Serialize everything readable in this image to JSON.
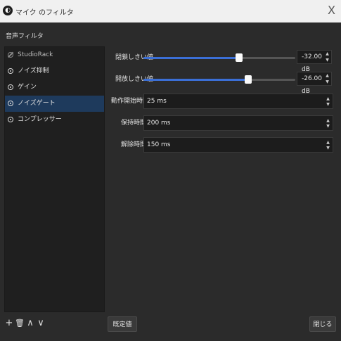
{
  "window": {
    "title": "マイク のフィルタ",
    "close_glyph": "X",
    "app_icon": "obs-logo"
  },
  "section_label": "音声フィルタ",
  "filters": [
    {
      "label": "StudioRack",
      "enabled": false,
      "selected": false
    },
    {
      "label": "ノイズ抑制",
      "enabled": true,
      "selected": false
    },
    {
      "label": "ゲイン",
      "enabled": true,
      "selected": false
    },
    {
      "label": "ノイズゲート",
      "enabled": true,
      "selected": true
    },
    {
      "label": "コンプレッサー",
      "enabled": true,
      "selected": false
    }
  ],
  "toolbar": {
    "add": "+",
    "remove": "🗑",
    "up": "∧",
    "down": "∨"
  },
  "properties": {
    "close_threshold": {
      "label": "閉鎖しきい値",
      "value": "-32.00 dB",
      "level": 0.63
    },
    "open_threshold": {
      "label": "開放しきい値",
      "value": "-26.00 dB",
      "level": 0.69
    },
    "attack": {
      "label": "動作開始時間",
      "value": "25 ms"
    },
    "hold": {
      "label": "保持時間",
      "value": "200 ms"
    },
    "release": {
      "label": "解除時間",
      "value": "150 ms"
    }
  },
  "buttons": {
    "defaults": "既定値",
    "close": "閉じる"
  },
  "colors": {
    "accent": "#3b6fd6",
    "selection": "#1e3a5c",
    "background": "#2b2b2b"
  }
}
